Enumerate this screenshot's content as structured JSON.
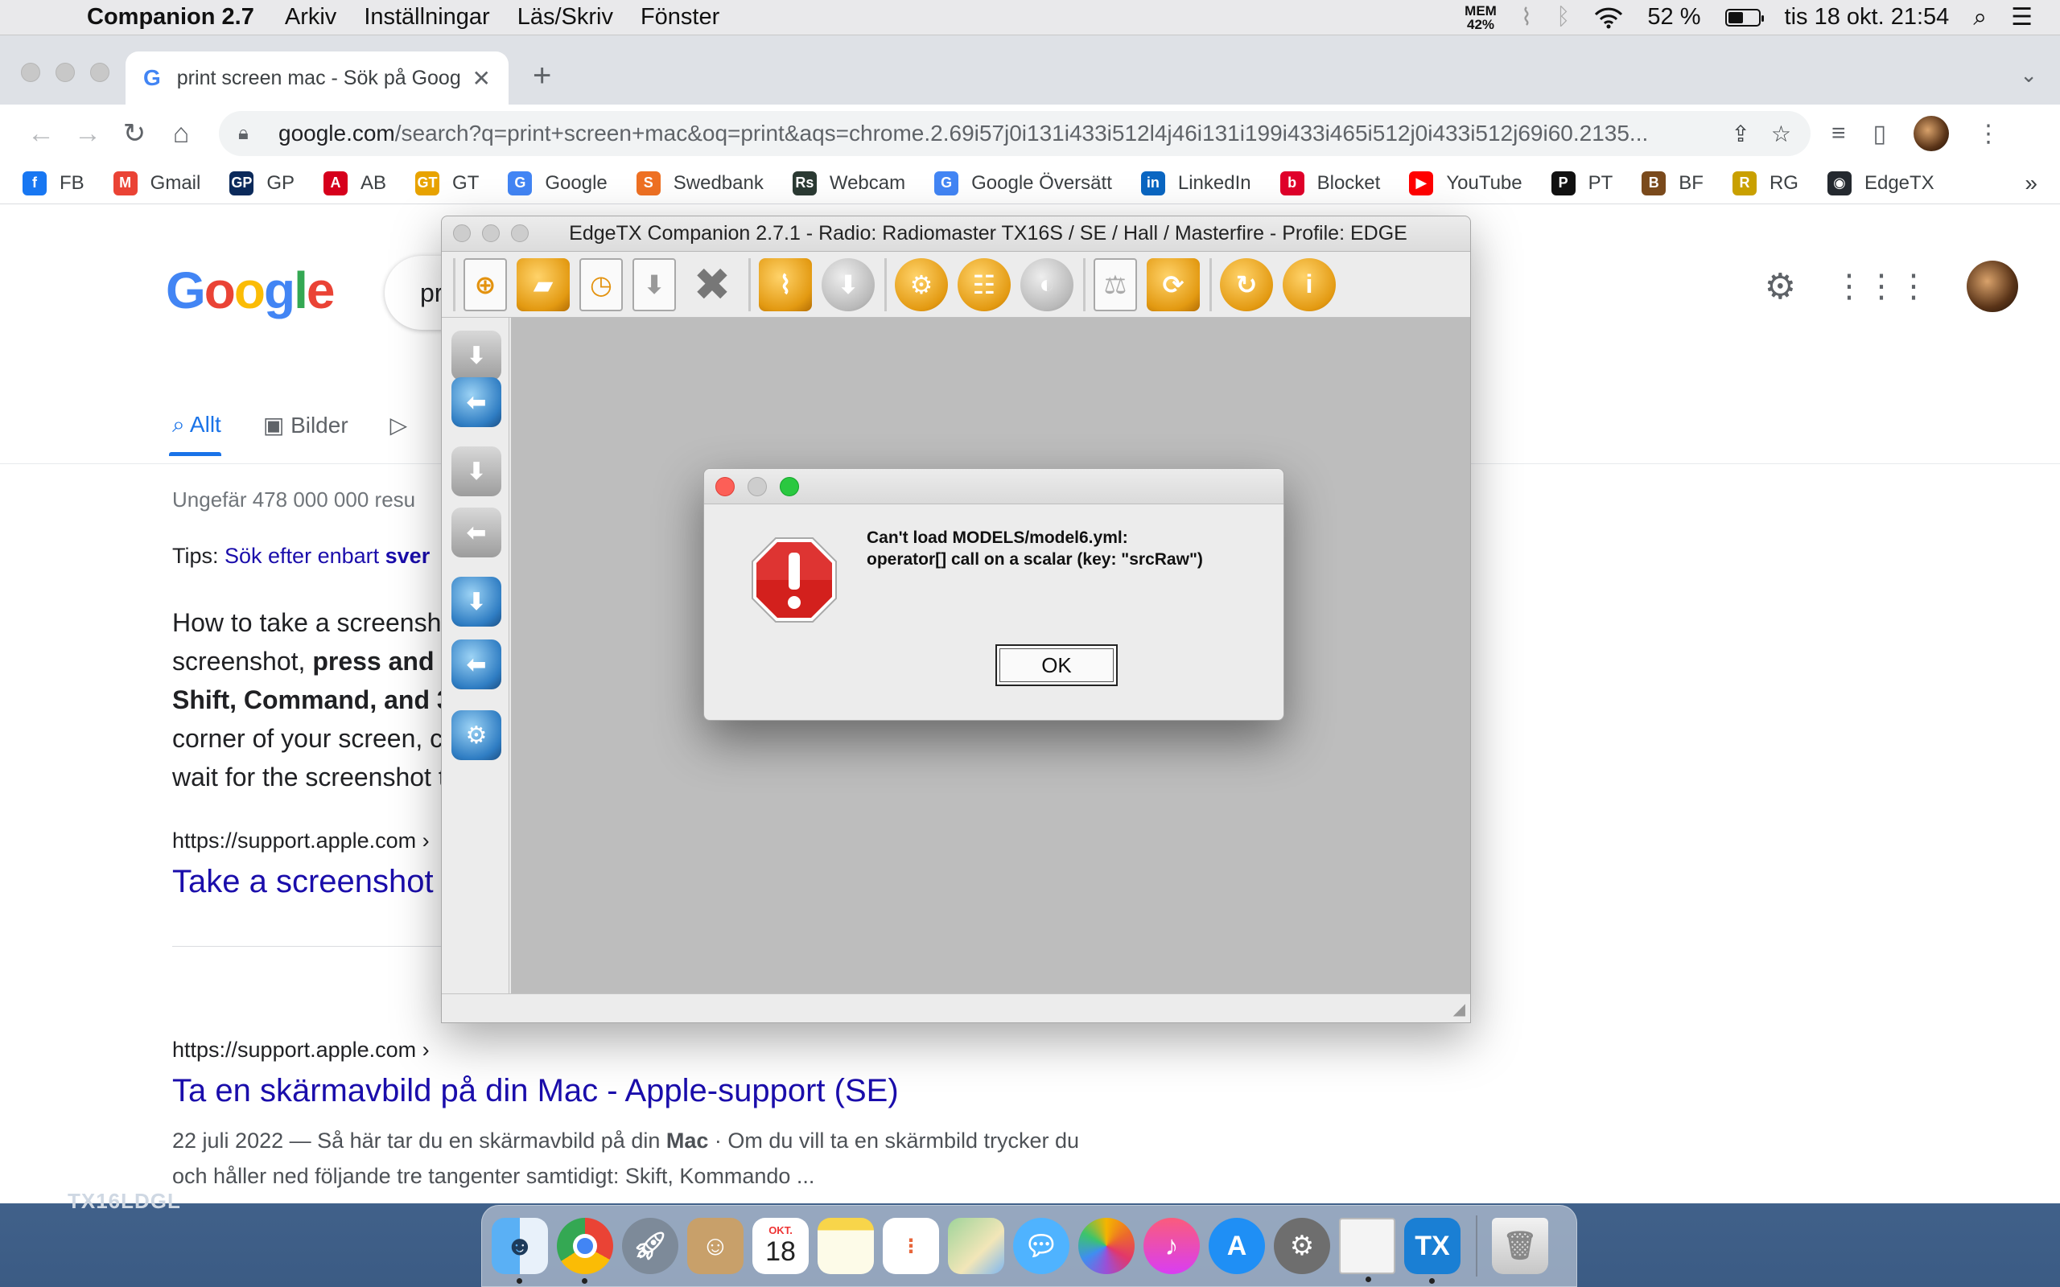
{
  "menubar": {
    "app_name": "Companion 2.7",
    "menus": [
      "Arkiv",
      "Inställningar",
      "Läs/Skriv",
      "Fönster"
    ],
    "mem_label": "MEM",
    "mem_value": "42%",
    "battery": "52 %",
    "battery_level": 0.52,
    "clock": "tis 18 okt.  21:54"
  },
  "chrome": {
    "tab_title": "print screen mac - Sök på Goog",
    "url_host": "google.com",
    "url_path": "/search?q=print+screen+mac&oq=print&aqs=chrome.2.69i57j0i131i433i512l4j46i131i199i433i465i512j0i433i512j69i60.2135...",
    "bookmarks": [
      {
        "label": "FB",
        "icon": "facebook-icon",
        "color": "#1877f2",
        "glyph": "f"
      },
      {
        "label": "Gmail",
        "icon": "gmail-icon",
        "color": "#ea4335",
        "glyph": "M"
      },
      {
        "label": "GP",
        "icon": "gp-icon",
        "color": "#0b2a5b",
        "glyph": "GP"
      },
      {
        "label": "AB",
        "icon": "aftonbladet-icon",
        "color": "#d6001c",
        "glyph": "A"
      },
      {
        "label": "GT",
        "icon": "gt-icon",
        "color": "#e8a300",
        "glyph": "GT"
      },
      {
        "label": "Google",
        "icon": "google-icon",
        "color": "#4285f4",
        "glyph": "G"
      },
      {
        "label": "Swedbank",
        "icon": "swedbank-icon",
        "color": "#ee7023",
        "glyph": "S"
      },
      {
        "label": "Webcam",
        "icon": "webcam-icon",
        "color": "#2b3a33",
        "glyph": "Rs"
      },
      {
        "label": "Google Översätt",
        "icon": "translate-icon",
        "color": "#4285f4",
        "glyph": "G"
      },
      {
        "label": "LinkedIn",
        "icon": "linkedin-icon",
        "color": "#0a66c2",
        "glyph": "in"
      },
      {
        "label": "Blocket",
        "icon": "blocket-icon",
        "color": "#e0002a",
        "glyph": "b"
      },
      {
        "label": "YouTube",
        "icon": "youtube-icon",
        "color": "#ff0000",
        "glyph": "▶"
      },
      {
        "label": "PT",
        "icon": "pt-icon",
        "color": "#111111",
        "glyph": "P"
      },
      {
        "label": "BF",
        "icon": "bf-icon",
        "color": "#7a4a1c",
        "glyph": "B"
      },
      {
        "label": "RG",
        "icon": "rg-icon",
        "color": "#c9a000",
        "glyph": "R"
      },
      {
        "label": "EdgeTX",
        "icon": "github-icon",
        "color": "#24292f",
        "glyph": "◉"
      }
    ],
    "bookmarks_more": "»"
  },
  "google": {
    "search_value": "pr",
    "tabs": [
      "Allt",
      "Bilder"
    ],
    "result_count": "Ungefär 478 000 000 resu",
    "tips_prefix": "Tips: ",
    "tips_link": "Sök efter enbart ",
    "tips_bold": "sver",
    "snippet_line1_a": "How to take a screensh",
    "snippet_line2_a": "screenshot, ",
    "snippet_line2_b": "press and",
    "snippet_line3": "Shift, Command, and 3",
    "snippet_line4": "corner of your screen, c",
    "snippet_line5": "wait for the screenshot t",
    "source1": "https://support.apple.com ›",
    "link1": "Take a screenshot",
    "source2": "https://support.apple.com ›",
    "link2": "Ta en skärmavbild på din Mac - Apple-support (SE)",
    "desc_a": "22 juli 2022 — Så här tar du en skärmavbild på din ",
    "desc_bold": "Mac",
    "desc_b": " · Om du vill ta en skärmbild trycker du",
    "desc_line2": "och håller ned följande tre tangenter samtidigt: Skift, Kommando ..."
  },
  "companion": {
    "title": "EdgeTX Companion 2.7.1 - Radio: Radiomaster TX16S / SE / Hall / Masterfire - Profile: EDGE"
  },
  "dialog": {
    "message_line1": "Can't load MODELS/model6.yml:",
    "message_line2": "operator[] call on a scalar (key: \"srcRaw\")",
    "ok_label": "OK"
  },
  "dock": {
    "calendar_month": "OKT.",
    "calendar_day": "18",
    "edgetx_label": "TX"
  },
  "desktop_label": "TX16LDGL"
}
